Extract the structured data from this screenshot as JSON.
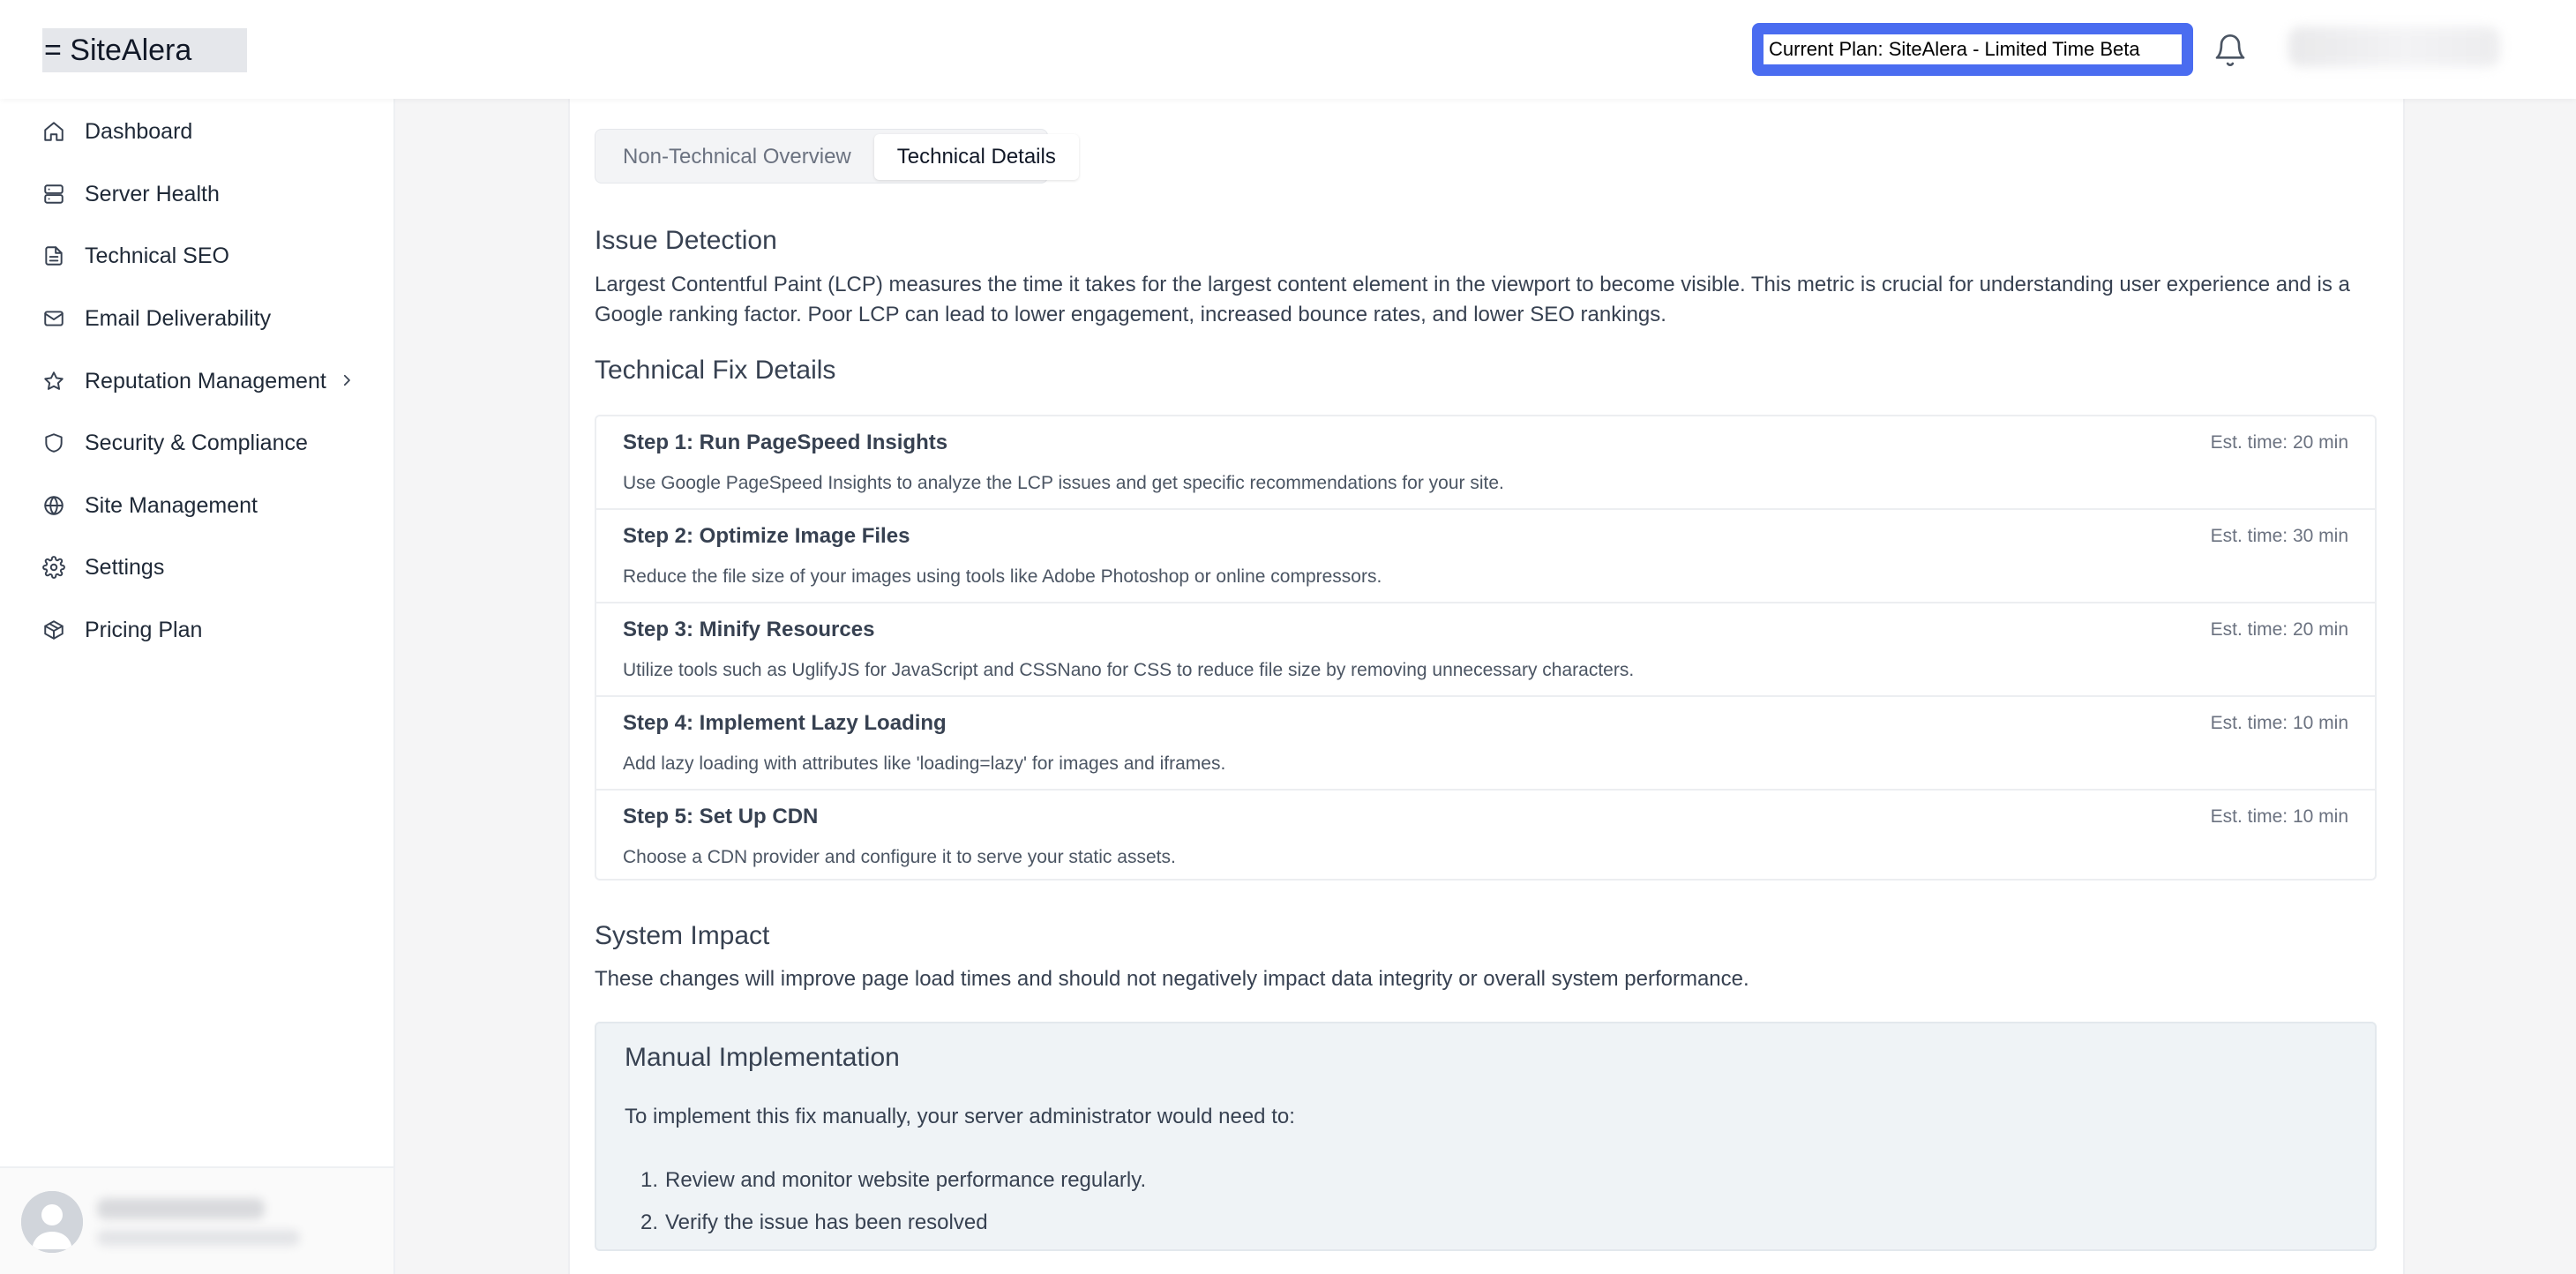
{
  "header": {
    "logo": "= SiteAlera",
    "plan_badge": "Current Plan: SiteAlera - Limited Time Beta",
    "bell_icon": "bell-icon"
  },
  "sidebar": {
    "items": [
      {
        "label": "Dashboard",
        "icon": "home-icon"
      },
      {
        "label": "Server Health",
        "icon": "server-icon"
      },
      {
        "label": "Technical SEO",
        "icon": "document-icon"
      },
      {
        "label": "Email Deliverability",
        "icon": "mail-icon"
      },
      {
        "label": "Reputation Management",
        "icon": "star-icon"
      },
      {
        "label": "Security & Compliance",
        "icon": "shield-icon"
      },
      {
        "label": "Site Management",
        "icon": "globe-icon"
      },
      {
        "label": "Settings",
        "icon": "gear-icon"
      },
      {
        "label": "Pricing Plan",
        "icon": "package-icon"
      }
    ]
  },
  "tabs": [
    {
      "label": "Non-Technical Overview",
      "active": false
    },
    {
      "label": "Technical Details",
      "active": true
    }
  ],
  "issue_detection": {
    "title": "Issue Detection",
    "text": "Largest Contentful Paint (LCP) measures the time it takes for the largest content element in the viewport to become visible. This metric is crucial for understanding user experience and is a Google ranking factor. Poor LCP can lead to lower engagement, increased bounce rates, and lower SEO rankings."
  },
  "technical_fix": {
    "title": "Technical Fix Details",
    "steps": [
      {
        "title": "Step 1: Run PageSpeed Insights",
        "time": "Est. time: 20 min",
        "desc": "Use Google PageSpeed Insights to analyze the LCP issues and get specific recommendations for your site."
      },
      {
        "title": "Step 2: Optimize Image Files",
        "time": "Est. time: 30 min",
        "desc": "Reduce the file size of your images using tools like Adobe Photoshop or online compressors."
      },
      {
        "title": "Step 3: Minify Resources",
        "time": "Est. time: 20 min",
        "desc": "Utilize tools such as UglifyJS for JavaScript and CSSNano for CSS to reduce file size by removing unnecessary characters."
      },
      {
        "title": "Step 4: Implement Lazy Loading",
        "time": "Est. time: 10 min",
        "desc": "Add lazy loading with attributes like 'loading=lazy' for images and iframes."
      },
      {
        "title": "Step 5: Set Up CDN",
        "time": "Est. time: 10 min",
        "desc": "Choose a CDN provider and configure it to serve your static assets."
      }
    ]
  },
  "system_impact": {
    "title": "System Impact",
    "text": "These changes will improve page load times and should not negatively impact data integrity or overall system performance."
  },
  "manual": {
    "title": "Manual Implementation",
    "intro": "To implement this fix manually, your server administrator would need to:",
    "items": [
      {
        "num": "1.",
        "text": "Review and monitor website performance regularly."
      },
      {
        "num": "2.",
        "text": "Verify the issue has been resolved"
      }
    ]
  }
}
